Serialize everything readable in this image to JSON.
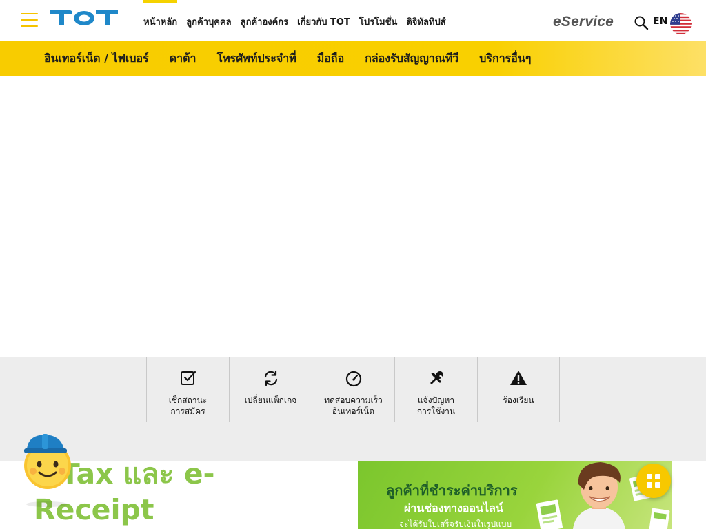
{
  "header": {
    "logo_text": "TOT",
    "nav": [
      {
        "label": "หน้าหลัก",
        "active": true
      },
      {
        "label": "ลูกค้าบุคคล",
        "active": false
      },
      {
        "label": "ลูกค้าองค์กร",
        "active": false
      },
      {
        "label": "เกี่ยวกับ TOT",
        "active": false
      },
      {
        "label": "โปรโมชั่น",
        "active": false
      },
      {
        "label": "ดิจิทัลทิปส์",
        "active": false
      }
    ],
    "eservice_label": "eService",
    "search_icon": "search-icon",
    "language_label": "EN",
    "flag_icon": "us-flag-icon"
  },
  "categories": [
    {
      "label": "อินเทอร์เน็ต / ไฟเบอร์"
    },
    {
      "label": "ดาต้า"
    },
    {
      "label": "โทรศัพท์ประจำที่"
    },
    {
      "label": "มือถือ"
    },
    {
      "label": "กล่องรับสัญญาณทีวี"
    },
    {
      "label": "บริการอื่นๆ"
    }
  ],
  "quick_menu": [
    {
      "label": "เช็กสถานะ การสมัคร",
      "icon": "checkbox-icon"
    },
    {
      "label": "เปลี่ยนแพ็กเกจ",
      "icon": "refresh-icon"
    },
    {
      "label": "ทดสอบความเร็ว อินเทอร์เน็ต",
      "icon": "speedometer-icon"
    },
    {
      "label": "แจ้งปัญหา การใช้งาน",
      "icon": "repair-tools-icon"
    },
    {
      "label": "ร้องเรียน",
      "icon": "warning-icon"
    }
  ],
  "section": {
    "title": "e-Tax และ e-Receipt"
  },
  "promo": {
    "line1": "ลูกค้าที่ชำระค่าบริการ",
    "line2": "ผ่านช่องทางออนไลน์",
    "line3": "จะได้รับใบเสร็จรับเงินในรูปแบบ"
  },
  "colors": {
    "brand_yellow": "#f8cc00",
    "brand_blue": "#1f88c9",
    "title_green": "#8cc64a",
    "promo_green": "#7bc62d"
  }
}
